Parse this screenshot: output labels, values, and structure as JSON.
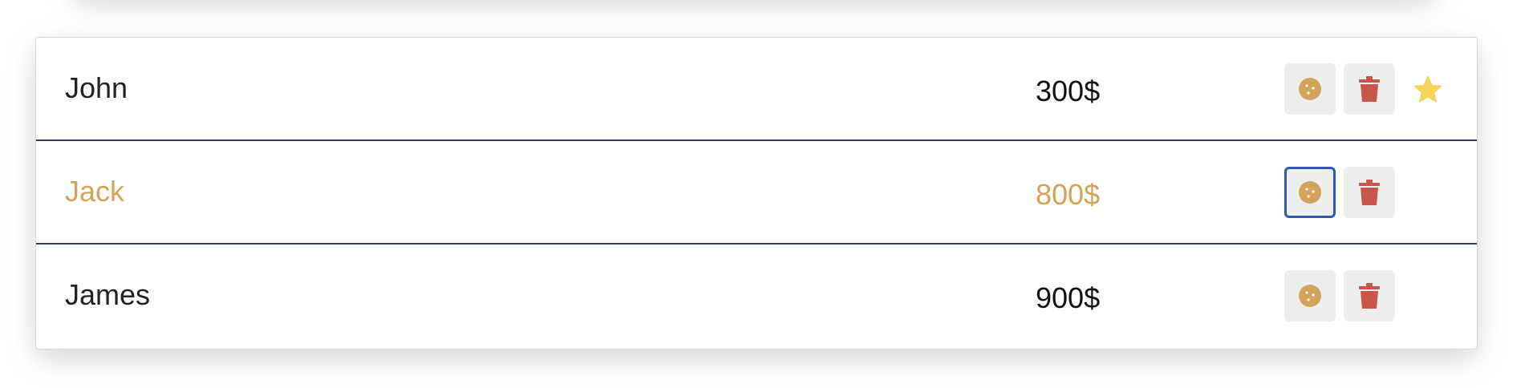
{
  "colors": {
    "cookie": "#d2a45a",
    "trash": "#c9564a",
    "star": "#f5d35a",
    "highlight_text": "#d2a45a",
    "divider": "#2c3a5c",
    "focus_ring": "#3358b8"
  },
  "rows": [
    {
      "name": "John",
      "amount": "300$",
      "favorite": true,
      "highlighted": false
    },
    {
      "name": "Jack",
      "amount": "800$",
      "favorite": false,
      "highlighted": true
    },
    {
      "name": "James",
      "amount": "900$",
      "favorite": false,
      "highlighted": false
    }
  ],
  "icons": {
    "cookie": "cookie-icon",
    "trash": "trash-icon",
    "star": "star-icon"
  }
}
